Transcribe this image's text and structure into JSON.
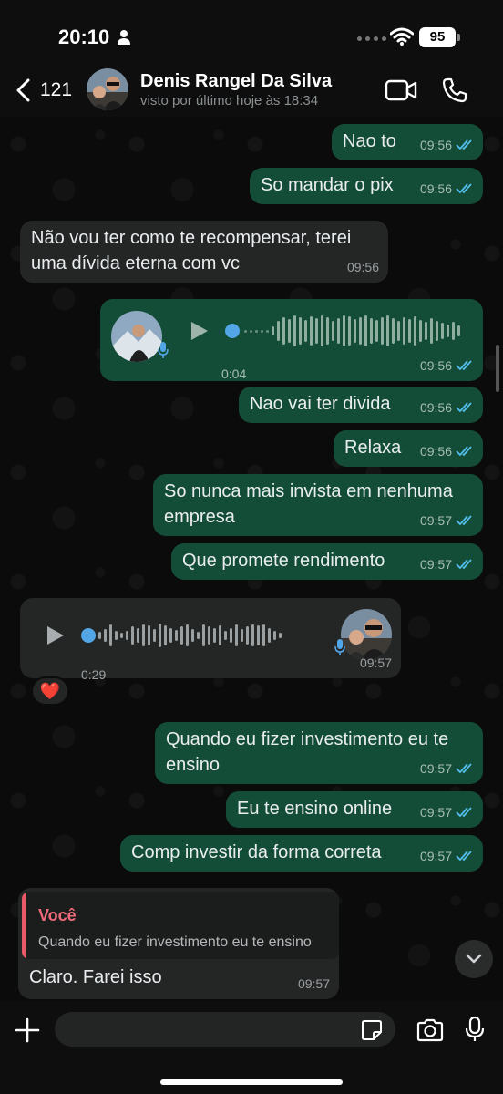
{
  "status_bar": {
    "time": "20:10",
    "battery": "95"
  },
  "header": {
    "back_count": "121",
    "contact_name": "Denis Rangel Da Silva",
    "last_seen": "visto por último hoje às 18:34"
  },
  "messages": [
    {
      "dir": "out",
      "type": "text",
      "text": "Nao to",
      "time": "09:56",
      "read": true
    },
    {
      "dir": "out",
      "type": "text",
      "text": "So mandar o pix",
      "time": "09:56",
      "read": true
    },
    {
      "dir": "in",
      "type": "text",
      "lines": [
        "Não vou ter como te recompensar, terei",
        "uma dívida eterna com vc"
      ],
      "time": "09:56"
    },
    {
      "dir": "out",
      "type": "voice",
      "duration": "0:04",
      "time": "09:56",
      "read": true
    },
    {
      "dir": "out",
      "type": "text",
      "text": "Nao vai ter divida",
      "time": "09:56",
      "read": true
    },
    {
      "dir": "out",
      "type": "text",
      "text": "Relaxa",
      "time": "09:56",
      "read": true
    },
    {
      "dir": "out",
      "type": "text",
      "lines": [
        "So nunca mais invista em nenhuma",
        "empresa"
      ],
      "time": "09:57",
      "read": true
    },
    {
      "dir": "out",
      "type": "text",
      "text": "Que promete rendimento",
      "time": "09:57",
      "read": true
    },
    {
      "dir": "in",
      "type": "voice",
      "duration": "0:29",
      "time": "09:57",
      "reaction": "❤️"
    },
    {
      "dir": "out",
      "type": "text",
      "lines": [
        "Quando eu fizer investimento eu te",
        "ensino"
      ],
      "time": "09:57",
      "read": true
    },
    {
      "dir": "out",
      "type": "text",
      "text": "Eu te ensino online",
      "time": "09:57",
      "read": true
    },
    {
      "dir": "out",
      "type": "text",
      "text": "Comp investir da forma correta",
      "time": "09:57",
      "read": true
    },
    {
      "dir": "in",
      "type": "reply",
      "quote_author": "Você",
      "quote_text": "Quando eu fizer investimento eu te ensino",
      "text": "Claro. Farei isso",
      "time": "09:57"
    }
  ],
  "input": {
    "placeholder": ""
  },
  "colors": {
    "outgoing": "#144d37",
    "incoming": "#242626",
    "read_ticks": "#53bdeb",
    "quote_accent": "#e85a6a",
    "voice_knob": "#53a6e6"
  }
}
